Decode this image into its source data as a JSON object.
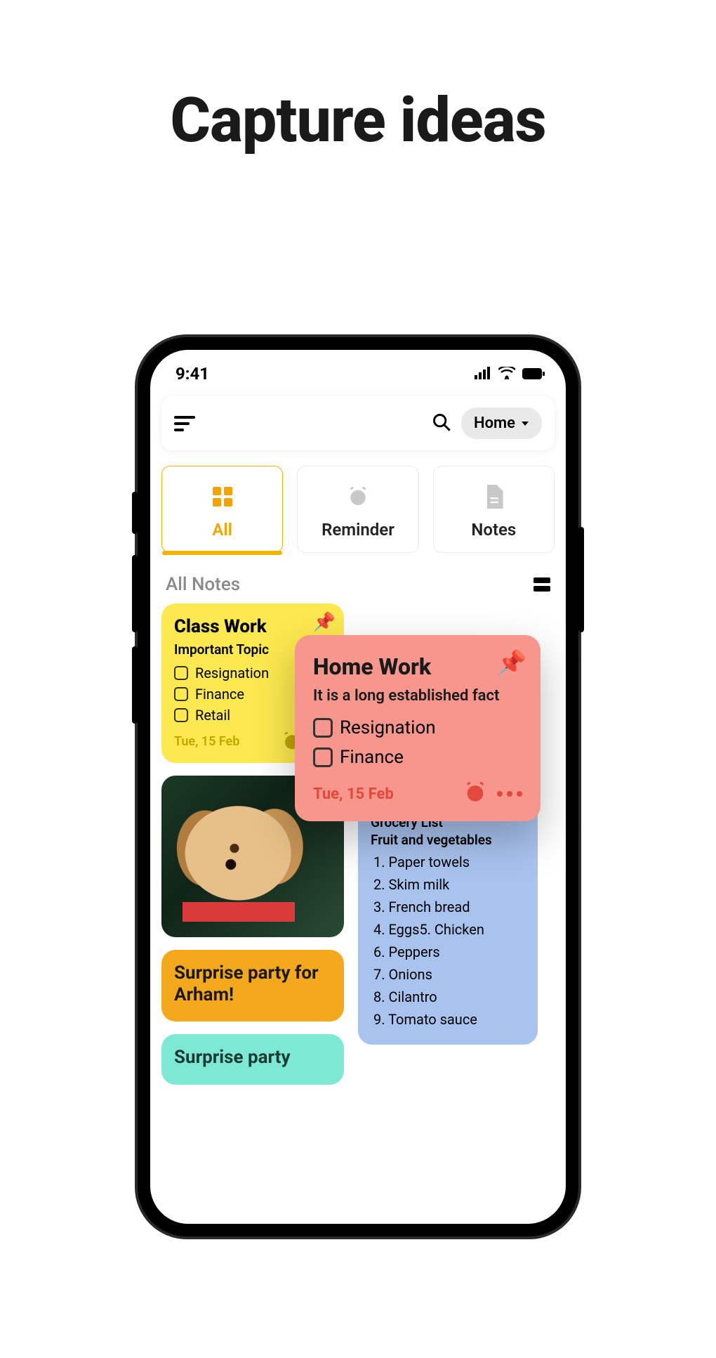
{
  "hero": {
    "title": "Capture ideas"
  },
  "statusbar": {
    "time": "9:41"
  },
  "topbar": {
    "home_label": "Home"
  },
  "categories": [
    {
      "label": "All",
      "active": true
    },
    {
      "label": "Reminder",
      "active": false
    },
    {
      "label": "Notes",
      "active": false
    }
  ],
  "section": {
    "title": "All Notes"
  },
  "cards": {
    "classwork": {
      "title": "Class Work",
      "subtitle": "Important Topic",
      "items": [
        "Resignation",
        "Finance",
        "Retail"
      ],
      "date": "Tue, 15 Feb"
    },
    "surprise1": {
      "title": "Surprise party for Arham!"
    },
    "surprise2": {
      "title": "Surprise party"
    },
    "grocery": {
      "title": "Grocery List",
      "subtitle": "Fruit and vegetables",
      "items": [
        "1. Paper towels",
        "2. Skim milk",
        "3. French bread",
        "4. Eggs5. Chicken",
        "6. Peppers",
        "7. Onions",
        "8. Cilantro",
        "9. Tomato sauce"
      ]
    }
  },
  "float": {
    "title": "Home Work",
    "subtitle": "It is a long established fact",
    "items": [
      "Resignation",
      "Finance"
    ],
    "date": "Tue, 15 Feb"
  }
}
